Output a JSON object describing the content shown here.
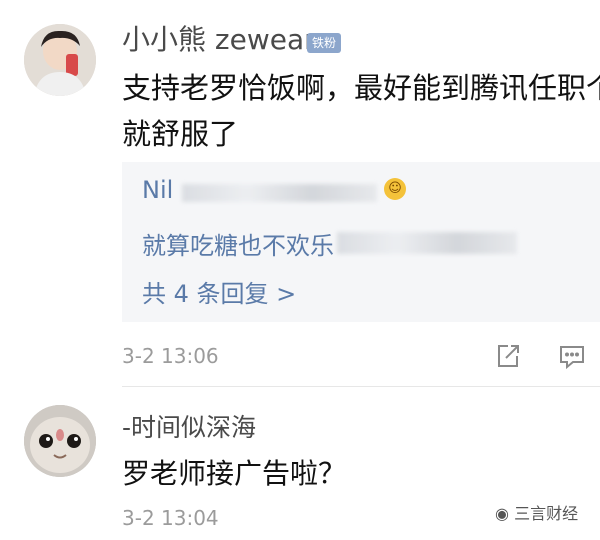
{
  "comments": [
    {
      "username": "小小熊 zewean",
      "badge": "铁粉",
      "text": "支持老罗恰饭啊，最好能到腾讯任职个\n就舒服了",
      "timestamp": "3-2 13:06",
      "replies": {
        "line1": "Nil",
        "line2": "就算吃糖也不欢乐",
        "more": "共 4 条回复 >"
      }
    },
    {
      "username": "-时间似深海",
      "text": "罗老师接广告啦？",
      "timestamp": "3-2 13:04"
    }
  ],
  "watermark": "三言财经",
  "icons": [
    "share-icon",
    "comment-icon"
  ]
}
